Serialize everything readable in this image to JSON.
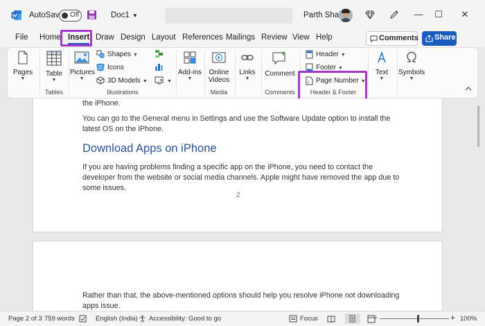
{
  "titlebar": {
    "autosave_label": "AutoSave",
    "autosave_state": "Off",
    "document_name": "Doc1",
    "user_name": "Parth Shah",
    "minimize": "—",
    "maximize": "☐",
    "close": "✕"
  },
  "tabs": [
    "File",
    "Home",
    "Insert",
    "Draw",
    "Design",
    "Layout",
    "References",
    "Mailings",
    "Review",
    "View",
    "Help"
  ],
  "active_tab": "Insert",
  "actions": {
    "comments_label": "Comments",
    "share_label": "Share"
  },
  "ribbon": {
    "pages_label": "Pages",
    "table_label": "Table",
    "tables_group": "Tables",
    "pictures_label": "Pictures",
    "shapes_label": "Shapes",
    "icons_label": "Icons",
    "models_label": "3D Models",
    "illustrations_group": "Illustrations",
    "addins_label": "Add-ins",
    "online_videos_label": "Online Videos",
    "media_group": "Media",
    "links_label": "Links",
    "comment_label": "Comment",
    "comments_group": "Comments",
    "header_label": "Header",
    "footer_label": "Footer",
    "page_number_label": "Page Number",
    "header_footer_group": "Header & Footer",
    "text_label": "Text",
    "symbols_label": "Symbols"
  },
  "document": {
    "page1_fragment": "the iPhone.",
    "page1_para1": "You can go to the General menu in Settings and use the Software Update option to install the latest OS on the iPhone.",
    "page1_heading": "Download Apps on iPhone",
    "page1_para2": "If you are having problems finding a specific app on the iPhone, you need to contact the developer from the website or social media channels. Apple might have removed the app due to some issues.",
    "page_number": "2",
    "page2_para": "Rather than that, the above-mentioned options should help you resolve iPhone not downloading apps issue."
  },
  "status": {
    "page": "Page 2 of 3",
    "words": "759 words",
    "language": "English (India)",
    "accessibility": "Accessibility: Good to go",
    "focus": "Focus",
    "zoom": "100%",
    "zoom_minus": "−",
    "zoom_plus": "+"
  },
  "colors": {
    "word_blue": "#185abd",
    "highlight": "#a239ca",
    "heading": "#2f5496",
    "share": "#1a5bbf"
  }
}
